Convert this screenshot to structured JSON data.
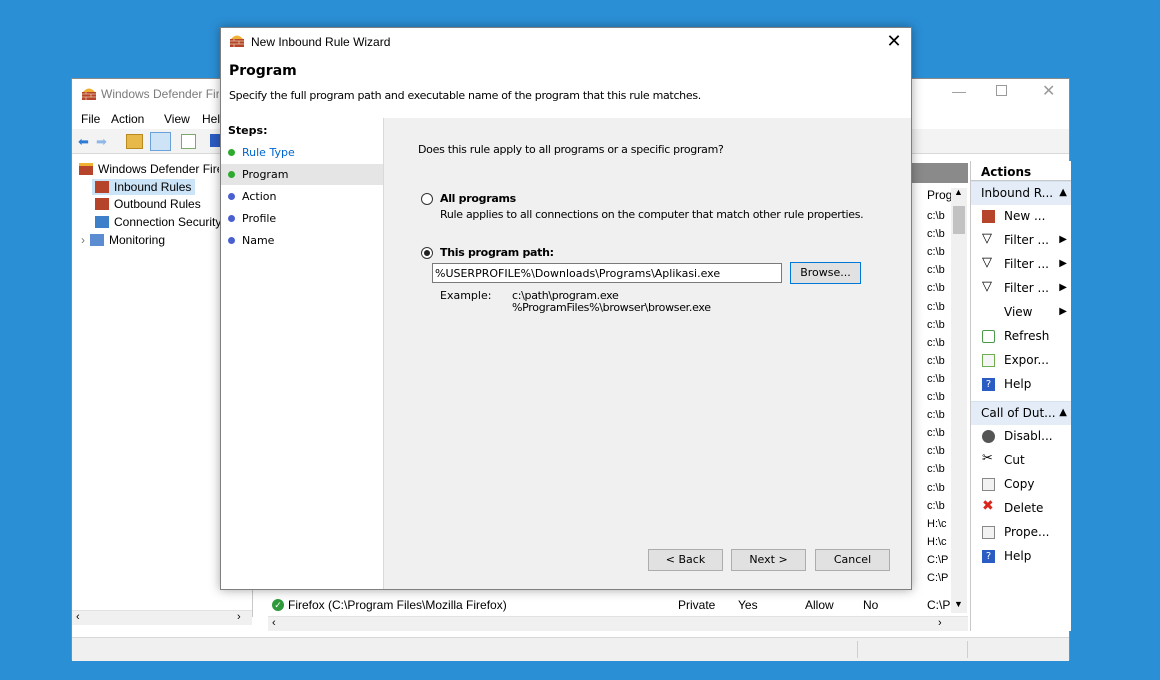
{
  "bg_window": {
    "title": "Windows Defender Firewall with Advanced Security",
    "menu": [
      "File",
      "Action",
      "View",
      "Help"
    ],
    "tree": [
      {
        "label": "Windows Defender Firewall with Advanced Security",
        "icon": "firewall-icon"
      },
      {
        "label": "Inbound Rules",
        "icon": "inbound-rules-icon",
        "selected": true
      },
      {
        "label": "Outbound Rules",
        "icon": "outbound-rules-icon"
      },
      {
        "label": "Connection Security Rules",
        "icon": "connection-security-icon"
      },
      {
        "label": "Monitoring",
        "icon": "monitoring-icon"
      }
    ],
    "list": {
      "col_program": "Prog",
      "program_cells": [
        "c:\\b",
        "c:\\b",
        "c:\\b",
        "c:\\b",
        "c:\\b",
        "c:\\b",
        "c:\\b",
        "c:\\b",
        "c:\\b",
        "c:\\b",
        "c:\\b",
        "c:\\b",
        "c:\\b",
        "c:\\b",
        "c:\\b",
        "c:\\b",
        "c:\\b",
        "H:\\c",
        "H:\\c",
        "C:\\P",
        "C:\\P"
      ],
      "rows": [
        {
          "name": "Firefox (C:\\Program Files\\Mozilla Firefox)",
          "profile": "Private",
          "enabled": "Yes",
          "action": "Allow",
          "override": "No",
          "program": "C:\\P"
        }
      ]
    },
    "actions": {
      "header": "Actions",
      "groups": [
        {
          "title": "Inbound R...",
          "items": [
            {
              "label": "New ...",
              "icon": "new-rule-icon"
            },
            {
              "label": "Filter ...",
              "icon": "filter-icon",
              "submenu": true
            },
            {
              "label": "Filter ...",
              "icon": "filter-icon",
              "submenu": true
            },
            {
              "label": "Filter ...",
              "icon": "filter-icon",
              "submenu": true
            },
            {
              "label": "View",
              "icon": "",
              "submenu": true
            },
            {
              "label": "Refresh",
              "icon": "refresh-icon"
            },
            {
              "label": "Expor...",
              "icon": "export-icon"
            },
            {
              "label": "Help",
              "icon": "help-icon"
            }
          ]
        },
        {
          "title": "Call of Dut...",
          "items": [
            {
              "label": "Disabl...",
              "icon": "disable-icon"
            },
            {
              "label": "Cut",
              "icon": "cut-icon"
            },
            {
              "label": "Copy",
              "icon": "copy-icon"
            },
            {
              "label": "Delete",
              "icon": "delete-icon"
            },
            {
              "label": "Prope...",
              "icon": "properties-icon"
            },
            {
              "label": "Help",
              "icon": "help-icon"
            }
          ]
        }
      ]
    }
  },
  "wizard": {
    "title": "New Inbound Rule Wizard",
    "heading": "Program",
    "description": "Specify the full program path and executable name of the program that this rule matches.",
    "steps_header": "Steps:",
    "steps": [
      {
        "label": "Rule Type",
        "state": "done"
      },
      {
        "label": "Program",
        "state": "current"
      },
      {
        "label": "Action",
        "state": "pending"
      },
      {
        "label": "Profile",
        "state": "pending"
      },
      {
        "label": "Name",
        "state": "pending"
      }
    ],
    "question": "Does this rule apply to all programs or a specific program?",
    "option_all": "All programs",
    "option_all_desc": "Rule applies to all connections on the computer that match other rule properties.",
    "option_path": "This program path:",
    "path_value": "%USERPROFILE%\\Downloads\\Programs\\Aplikasi.exe",
    "browse": "Browse...",
    "example_label": "Example:",
    "example_1": "c:\\path\\program.exe",
    "example_2": "%ProgramFiles%\\browser\\browser.exe",
    "back": "< Back",
    "next": "Next >",
    "cancel": "Cancel"
  },
  "colors": {
    "desktop": "#2b8fd6",
    "done_dot": "#2eaa2e",
    "pending_dot": "#4a5fd0",
    "link_blue": "#0066cc"
  }
}
